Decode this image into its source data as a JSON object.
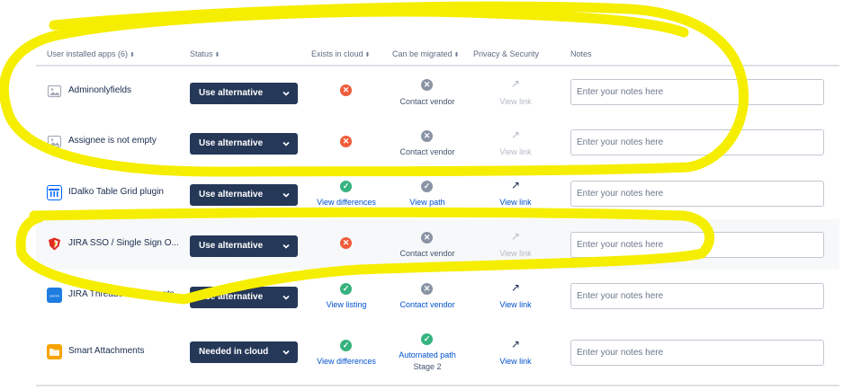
{
  "header": {
    "app_col": "User installed apps (6)",
    "status_col": "Status",
    "cloud_col": "Exists in cloud",
    "migrate_col": "Can be migrated",
    "privacy_col": "Privacy & Security",
    "notes_col": "Notes"
  },
  "notes_placeholder": "Enter your notes here",
  "rows": [
    {
      "name": "Adminonlyfields",
      "icon": "image-placeholder-icon",
      "status": "Use alternative",
      "cloud": {
        "icon": "error-icon",
        "label": ""
      },
      "migrate": {
        "icon": "cross-icon",
        "label": "Contact vendor",
        "label2": ""
      },
      "privacy": {
        "label": "View link",
        "enabled": false
      }
    },
    {
      "name": "Assignee is not empty",
      "icon": "image-placeholder-icon",
      "status": "Use alternative",
      "cloud": {
        "icon": "error-icon",
        "label": ""
      },
      "migrate": {
        "icon": "cross-icon",
        "label": "Contact vendor",
        "label2": ""
      },
      "privacy": {
        "label": "View link",
        "enabled": false
      }
    },
    {
      "name": "IDalko Table Grid plugin",
      "icon": "table-grid-icon",
      "status": "Use alternative",
      "cloud": {
        "icon": "check-icon",
        "label": "View differences"
      },
      "migrate": {
        "icon": "check-grey-icon",
        "label": "View path",
        "label2": ""
      },
      "privacy": {
        "label": "View link",
        "enabled": true
      }
    },
    {
      "name": "JIRA SSO / Single Sign O...",
      "icon": "shield-icon",
      "status": "Use alternative",
      "cloud": {
        "icon": "error-icon",
        "label": ""
      },
      "migrate": {
        "icon": "cross-icon",
        "label": "Contact vendor",
        "label2": ""
      },
      "privacy": {
        "label": "View link",
        "enabled": false
      }
    },
    {
      "name": "JIRA Threaded Comments",
      "icon": "comments-icon",
      "status": "Use alternative",
      "cloud": {
        "icon": "check-icon",
        "label": "View listing"
      },
      "migrate": {
        "icon": "cross-icon",
        "label": "Contact vendor",
        "label2": ""
      },
      "privacy": {
        "label": "View link",
        "enabled": true
      }
    },
    {
      "name": "Smart Attachments",
      "icon": "folder-icon",
      "status": "Needed in cloud",
      "cloud": {
        "icon": "check-icon",
        "label": "View differences"
      },
      "migrate": {
        "icon": "check-icon",
        "label": "Automated path",
        "label2": "Stage 2"
      },
      "privacy": {
        "label": "View link",
        "enabled": true
      }
    }
  ],
  "colors": {
    "select_bg": "#253858",
    "error": "#f15b3a",
    "success": "#36b37e",
    "neutral": "#8993a4",
    "link": "#0052cc",
    "highlight": "#f5ee00"
  }
}
